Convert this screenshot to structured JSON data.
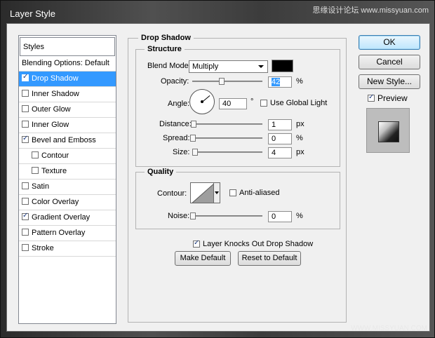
{
  "window": {
    "title": "Layer Style",
    "watermark_top": "思缘设计论坛 www.missyuan.com",
    "watermark_bottom": "WWW.MISSYUAN.COM"
  },
  "styles_list": {
    "header": "Styles",
    "items": [
      {
        "label": "Blending Options: Default",
        "checkbox": false,
        "checked": false,
        "selected": false,
        "indent": false
      },
      {
        "label": "Drop Shadow",
        "checkbox": true,
        "checked": true,
        "selected": true,
        "indent": false
      },
      {
        "label": "Inner Shadow",
        "checkbox": true,
        "checked": false,
        "selected": false,
        "indent": false
      },
      {
        "label": "Outer Glow",
        "checkbox": true,
        "checked": false,
        "selected": false,
        "indent": false
      },
      {
        "label": "Inner Glow",
        "checkbox": true,
        "checked": false,
        "selected": false,
        "indent": false
      },
      {
        "label": "Bevel and Emboss",
        "checkbox": true,
        "checked": true,
        "selected": false,
        "indent": false
      },
      {
        "label": "Contour",
        "checkbox": true,
        "checked": false,
        "selected": false,
        "indent": true
      },
      {
        "label": "Texture",
        "checkbox": true,
        "checked": false,
        "selected": false,
        "indent": true
      },
      {
        "label": "Satin",
        "checkbox": true,
        "checked": false,
        "selected": false,
        "indent": false
      },
      {
        "label": "Color Overlay",
        "checkbox": true,
        "checked": false,
        "selected": false,
        "indent": false
      },
      {
        "label": "Gradient Overlay",
        "checkbox": true,
        "checked": true,
        "selected": false,
        "indent": false
      },
      {
        "label": "Pattern Overlay",
        "checkbox": true,
        "checked": false,
        "selected": false,
        "indent": false
      },
      {
        "label": "Stroke",
        "checkbox": true,
        "checked": false,
        "selected": false,
        "indent": false
      }
    ]
  },
  "drop_shadow": {
    "section_title": "Drop Shadow",
    "structure": {
      "title": "Structure",
      "blend_mode_label": "Blend Mode:",
      "blend_mode_value": "Multiply",
      "shadow_color": "#000000",
      "opacity_label": "Opacity:",
      "opacity_value": "42",
      "opacity_unit": "%",
      "opacity_level": 0.42,
      "angle_label": "Angle:",
      "angle_value": "40",
      "angle_unit": "°",
      "global_light_label": "Use Global Light",
      "global_light_checked": false,
      "distance_label": "Distance:",
      "distance_value": "1",
      "distance_unit": "px",
      "spread_label": "Spread:",
      "spread_value": "0",
      "spread_unit": "%",
      "size_label": "Size:",
      "size_value": "4",
      "size_unit": "px"
    },
    "quality": {
      "title": "Quality",
      "contour_label": "Contour:",
      "anti_aliased_label": "Anti-aliased",
      "anti_aliased_checked": false,
      "noise_label": "Noise:",
      "noise_value": "0",
      "noise_unit": "%"
    },
    "knocks_out_label": "Layer Knocks Out Drop Shadow",
    "knocks_out_checked": true,
    "make_default_label": "Make Default",
    "reset_default_label": "Reset to Default"
  },
  "buttons": {
    "ok": "OK",
    "cancel": "Cancel",
    "new_style": "New Style...",
    "preview_label": "Preview",
    "preview_checked": true
  },
  "colors": {
    "selection": "#3399ff",
    "ok_focus": "#bee6fd"
  }
}
